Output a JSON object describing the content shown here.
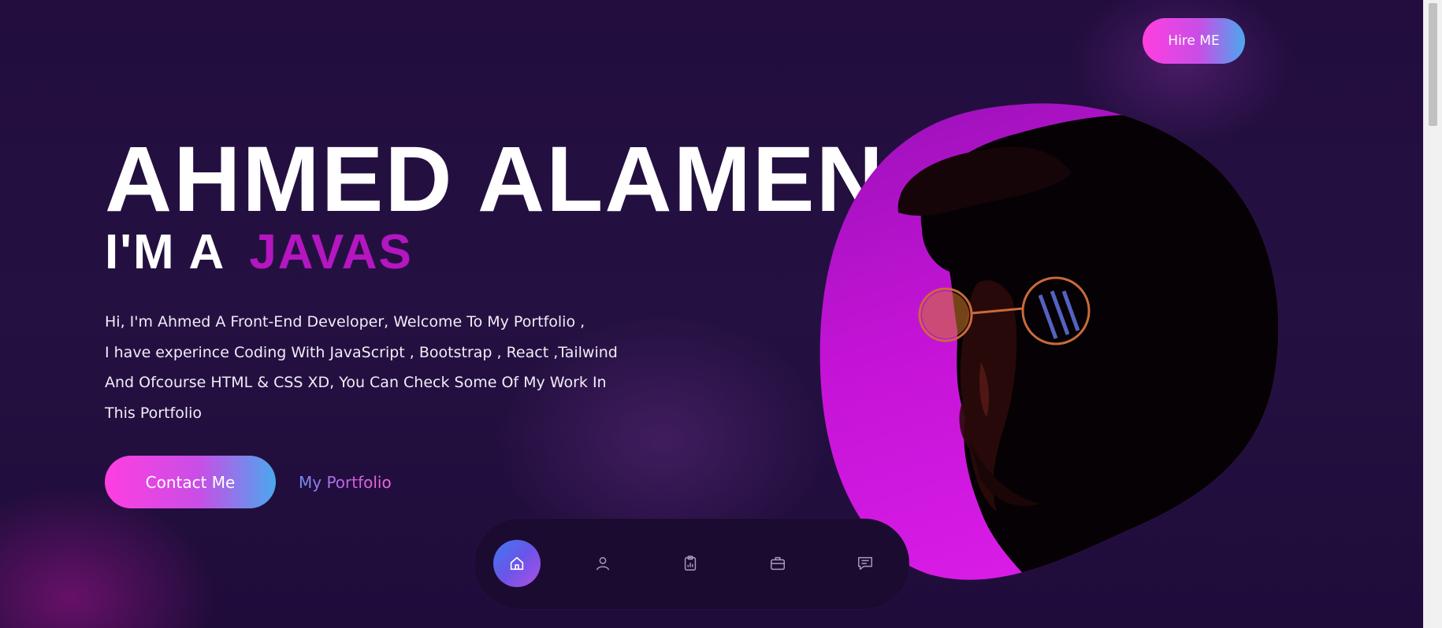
{
  "header": {
    "hire_label": "Hire ME"
  },
  "hero": {
    "name": "AHMED ALAMEN",
    "role_prefix": "I'M A",
    "role_typed": "JAVAS",
    "intro_lines": [
      "Hi, I'm Ahmed A Front-End Developer, Welcome To My Portfolio ,",
      "I have experince Coding With JavaScript , Bootstrap , React ,Tailwind",
      "And Ofcourse HTML & CSS XD, You Can Check Some Of My Work In",
      "This Portfolio"
    ],
    "contact_label": "Contact Me",
    "portfolio_label": "My Portfolio"
  },
  "nav": {
    "items": [
      {
        "icon": "home-icon",
        "active": true
      },
      {
        "icon": "user-icon",
        "active": false
      },
      {
        "icon": "clipboard-chart-icon",
        "active": false
      },
      {
        "icon": "briefcase-icon",
        "active": false
      },
      {
        "icon": "message-icon",
        "active": false
      }
    ]
  },
  "colors": {
    "background": "#220d3e",
    "accent_pink": "#ff3ee0",
    "accent_blue": "#4aa8ee",
    "role_highlight": "#b416c0",
    "blob": "#c413d6"
  }
}
